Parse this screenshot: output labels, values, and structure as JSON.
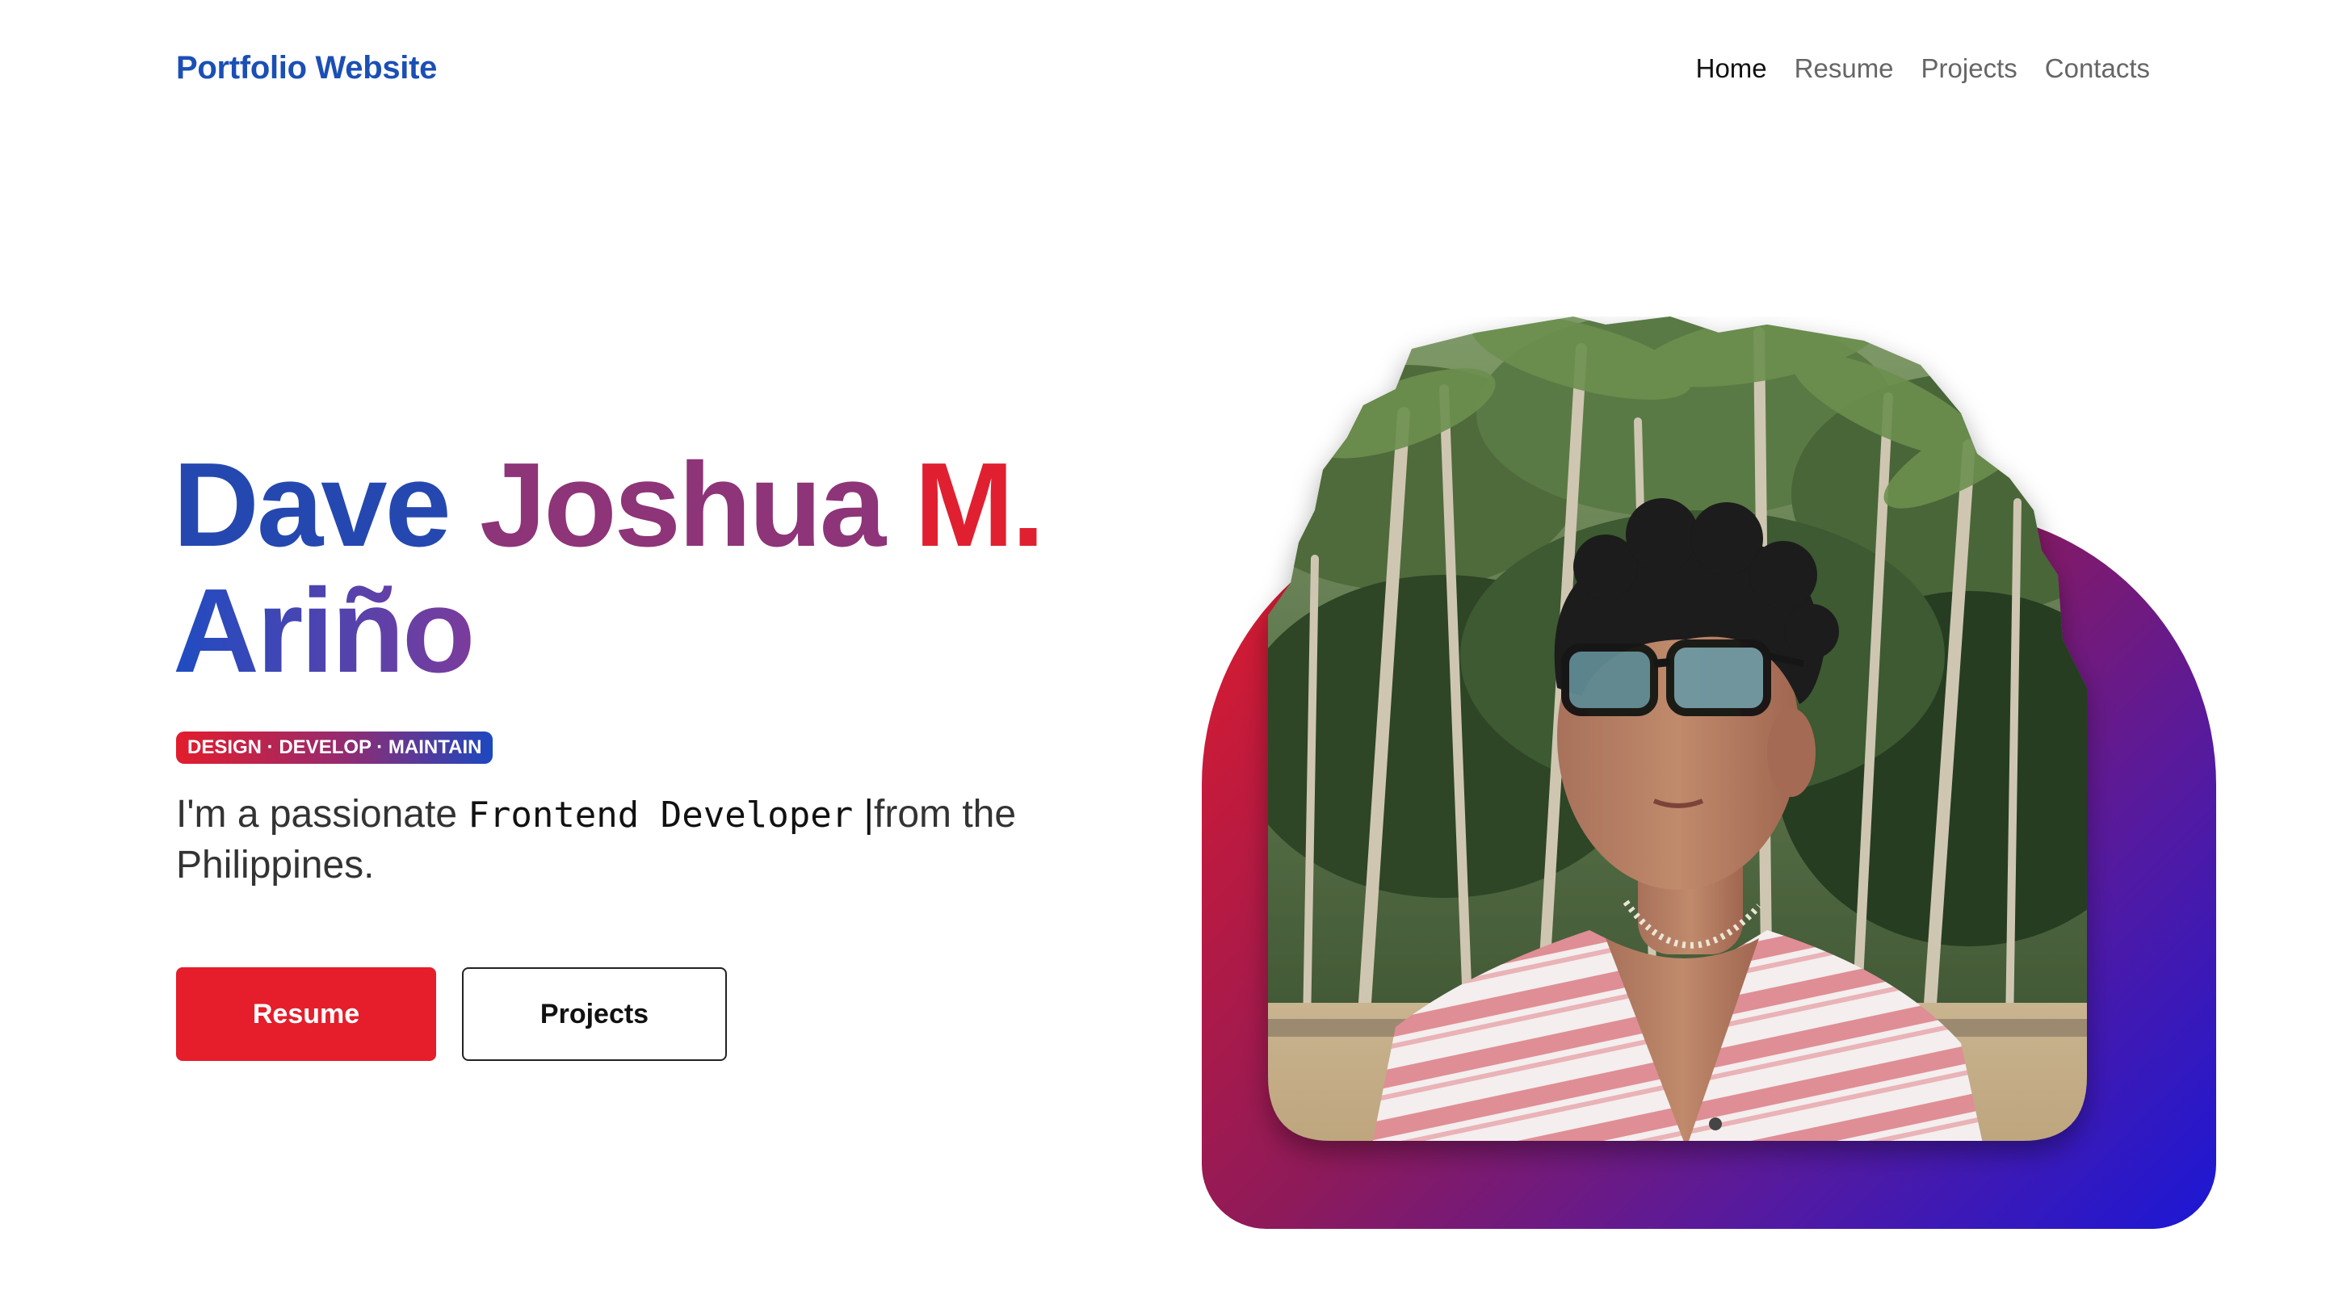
{
  "header": {
    "brand": "Portfolio Website",
    "nav": [
      {
        "label": "Home",
        "active": true
      },
      {
        "label": "Resume",
        "active": false
      },
      {
        "label": "Projects",
        "active": false
      },
      {
        "label": "Contacts",
        "active": false
      }
    ]
  },
  "hero": {
    "name_words": [
      "Dave",
      "Joshua",
      "M.",
      "Ariño"
    ],
    "tagline": "DESIGN · DEVELOP · MAINTAIN",
    "intro_prefix": "I'm a passionate ",
    "intro_role": "Frontend Developer",
    "intro_caret": " |",
    "intro_suffix": "from the Philippines.",
    "buttons": {
      "resume": "Resume",
      "projects": "Projects"
    }
  },
  "colors": {
    "brand_blue": "#1b4fb5",
    "accent_red": "#e61d2b",
    "gradient_purple": "#5a1a9a",
    "gradient_blue": "#1b18d6"
  },
  "image": {
    "icon": "portrait-photo"
  }
}
